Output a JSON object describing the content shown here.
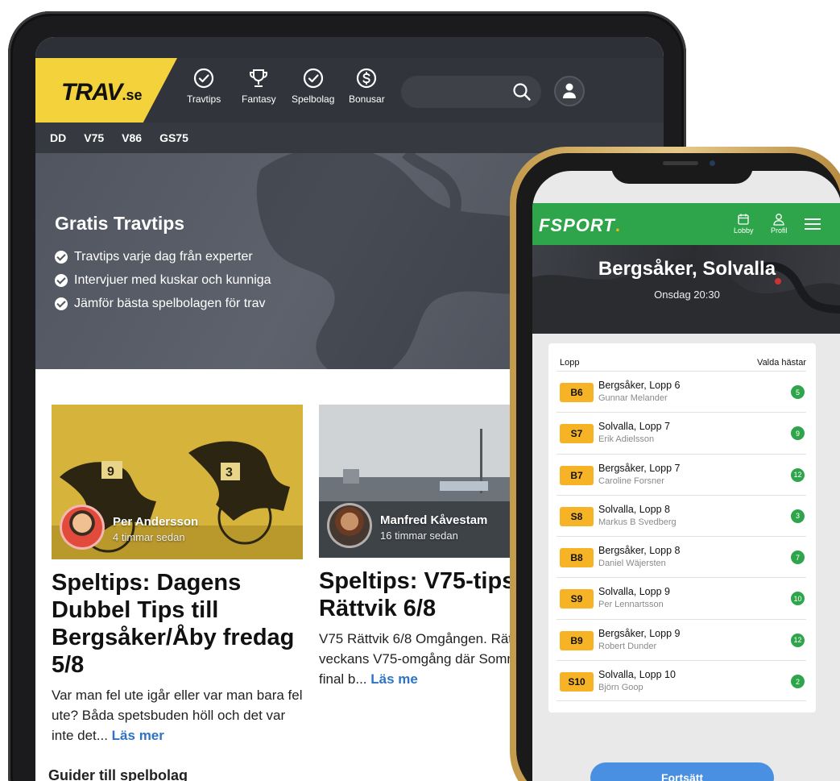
{
  "tablet": {
    "logo": {
      "main": "TRAV",
      "suffix": ".se"
    },
    "nav": [
      {
        "label": "Travtips",
        "icon": "check-circle-icon"
      },
      {
        "label": "Fantasy",
        "icon": "trophy-icon"
      },
      {
        "label": "Spelbolag",
        "icon": "check-circle-icon"
      },
      {
        "label": "Bonusar",
        "icon": "dollar-circle-icon"
      }
    ],
    "subnav": [
      "DD",
      "V75",
      "V86",
      "GS75"
    ],
    "hero": {
      "title": "Gratis Travtips",
      "items": [
        "Travtips varje dag från experter",
        "Intervjuer med kuskar och kunniga",
        "Jämför bästa spelbolagen för trav"
      ]
    },
    "articles": [
      {
        "author": "Per Andersson",
        "time": "4 timmar sedan",
        "title": "Speltips: Dagens Dubbel Tips till Bergsåker/Åby fredag 5/8",
        "excerpt": "Var man fel ute igår eller var man bara fel ute? Båda spetsbuden höll och det var inte det...",
        "read_more": "Läs mer"
      },
      {
        "author": "Manfred Kåvestam",
        "time": "16 timmar sedan",
        "title": "Speltips: V75-tips t Rättvik 6/8",
        "excerpt": "V75 Rättvik 6/8 Omgången. Rätt för veckans V75-omgång där Sommartravets final b...",
        "read_more": "Läs me"
      }
    ],
    "guides_heading": "Guider till spelbolag"
  },
  "phone": {
    "logo": {
      "main": "FSPORT",
      "dot": "."
    },
    "nav": [
      {
        "label": "Lobby",
        "icon": "calendar-icon"
      },
      {
        "label": "Profil",
        "icon": "user-icon"
      }
    ],
    "title": "Bergsåker, Solvalla",
    "subtitle": "Onsdag 20:30",
    "table_header": {
      "left": "Lopp",
      "right": "Valda hästar"
    },
    "races": [
      {
        "code": "B6",
        "race": "Bergsåker, Lopp 6",
        "driver": "Gunnar Melander",
        "count": "5"
      },
      {
        "code": "S7",
        "race": "Solvalla, Lopp 7",
        "driver": "Erik Adielsson",
        "count": "9"
      },
      {
        "code": "B7",
        "race": "Bergsåker, Lopp 7",
        "driver": "Caroline Forsner",
        "count": "12"
      },
      {
        "code": "S8",
        "race": "Solvalla, Lopp 8",
        "driver": "Markus B Svedberg",
        "count": "3"
      },
      {
        "code": "B8",
        "race": "Bergsåker, Lopp 8",
        "driver": "Daniel Wäjersten",
        "count": "7"
      },
      {
        "code": "S9",
        "race": "Solvalla, Lopp 9",
        "driver": "Per Lennartsson",
        "count": "10"
      },
      {
        "code": "B9",
        "race": "Bergsåker, Lopp 9",
        "driver": "Robert Dunder",
        "count": "12"
      },
      {
        "code": "S10",
        "race": "Solvalla, Lopp 10",
        "driver": "Björn Goop",
        "count": "2"
      }
    ],
    "continue_label": "Fortsätt"
  },
  "colors": {
    "trav_yellow": "#f4d23c",
    "trav_dark": "#31343a",
    "fsport_green": "#2ea54a",
    "badge_orange": "#f6b326",
    "button_blue": "#4a90e2",
    "link_blue": "#2f73c4"
  }
}
